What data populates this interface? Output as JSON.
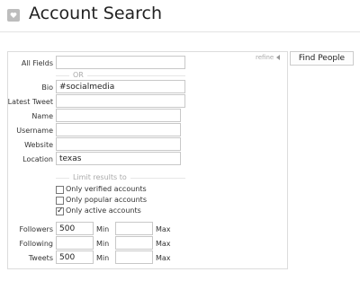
{
  "header": {
    "title": "Account Search",
    "icon": "heart-icon"
  },
  "refine": "refine",
  "find_button": "Find People",
  "fields": {
    "all_fields": {
      "label": "All Fields",
      "value": ""
    },
    "or_divider": "OR",
    "bio": {
      "label": "Bio",
      "value": "#socialmedia"
    },
    "latest_tweet": {
      "label": "Latest Tweet",
      "value": ""
    },
    "name": {
      "label": "Name",
      "value": ""
    },
    "username": {
      "label": "Username",
      "value": ""
    },
    "website": {
      "label": "Website",
      "value": ""
    },
    "location": {
      "label": "Location",
      "value": "texas"
    }
  },
  "limit_divider": "Limit results to",
  "checkboxes": [
    {
      "label": "Only verified accounts",
      "checked": false
    },
    {
      "label": "Only popular accounts",
      "checked": false
    },
    {
      "label": "Only active accounts",
      "checked": true
    }
  ],
  "ranges": [
    {
      "label": "Followers",
      "min": "500",
      "max": ""
    },
    {
      "label": "Following",
      "min": "",
      "max": ""
    },
    {
      "label": "Tweets",
      "min": "500",
      "max": ""
    }
  ],
  "min_label": "Min",
  "max_label": "Max"
}
